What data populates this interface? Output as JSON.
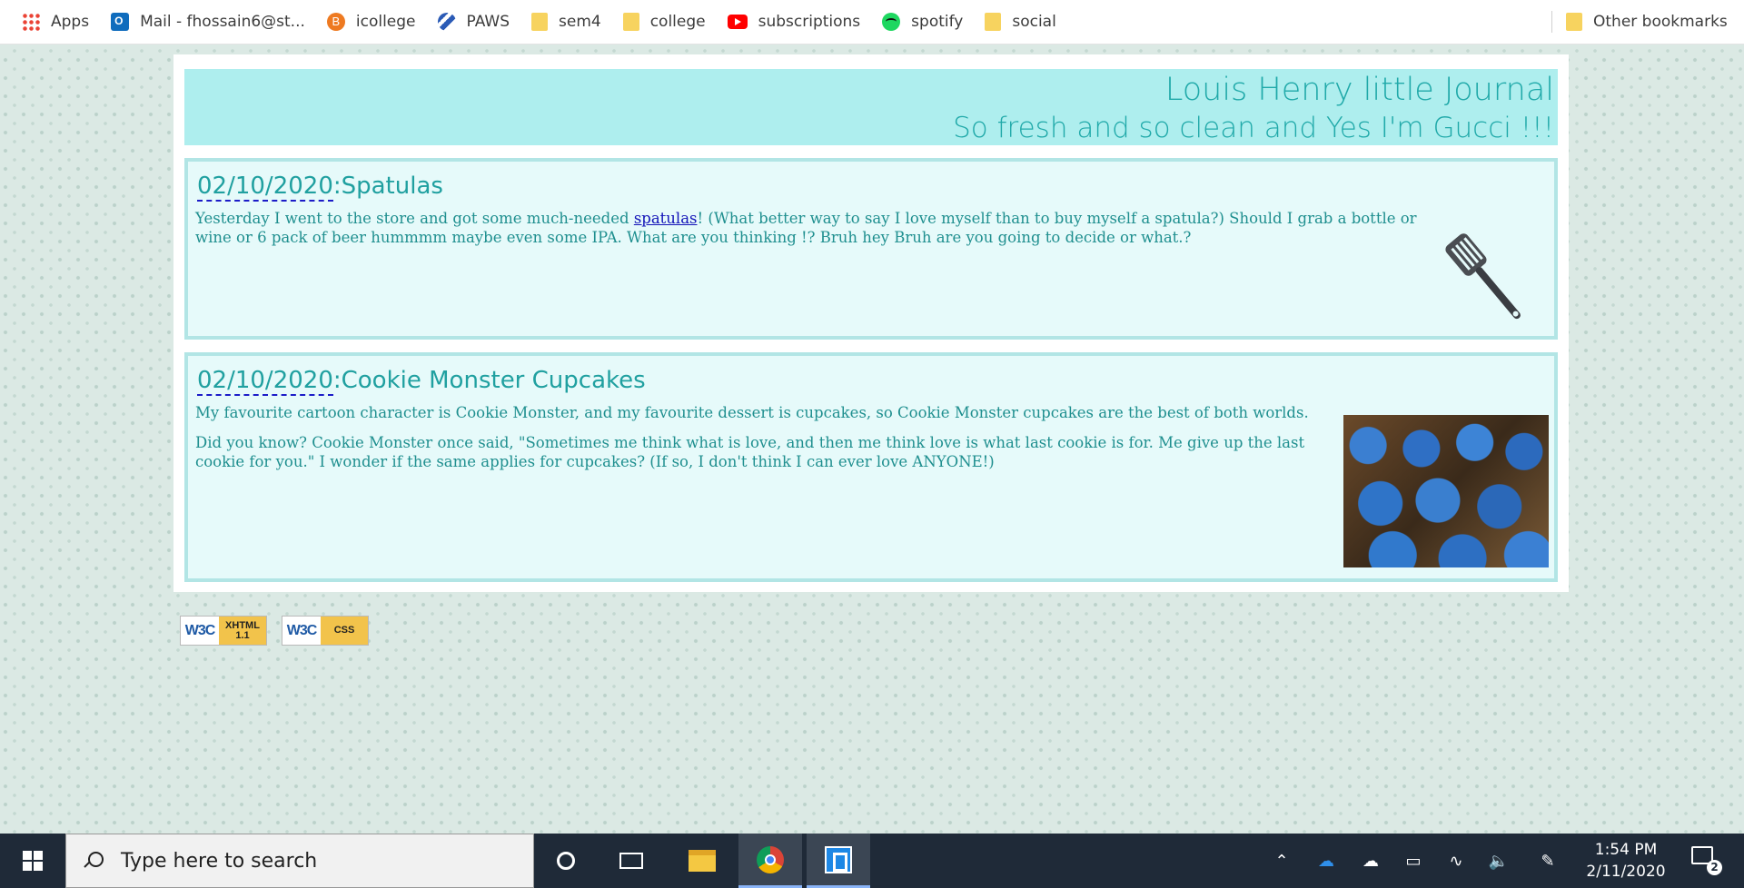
{
  "bookmarks": {
    "items": [
      {
        "label": "Apps",
        "icon": "apps-grid-icon"
      },
      {
        "label": "Mail - fhossain6@st...",
        "icon": "outlook-icon"
      },
      {
        "label": "icollege",
        "icon": "icollege-icon"
      },
      {
        "label": "PAWS",
        "icon": "paws-icon"
      },
      {
        "label": "sem4",
        "icon": "folder-icon"
      },
      {
        "label": "college",
        "icon": "folder-icon"
      },
      {
        "label": "subscriptions",
        "icon": "youtube-icon"
      },
      {
        "label": "spotify",
        "icon": "spotify-icon"
      },
      {
        "label": "social",
        "icon": "folder-icon"
      }
    ],
    "other": "Other bookmarks"
  },
  "header": {
    "title": "Louis Henry little Journal",
    "subtitle": "So fresh and so clean and Yes I'm Gucci !!!"
  },
  "entries": [
    {
      "date": "02/10/2020",
      "title": ":Spatulas",
      "p1_before": "Yesterday I went to the store and got some much-needed ",
      "p1_link": "spatulas",
      "p1_after": "! (What better way to say I love myself than to buy myself a spatula?) Should I grab a bottle or wine or 6 pack of beer hummmm maybe even some IPA. What are you thinking !? Bruh hey Bruh are you going to decide or what.?",
      "image": "spatula-image"
    },
    {
      "date": "02/10/2020",
      "title": ":Cookie Monster Cupcakes",
      "p1": "My favourite cartoon character is Cookie Monster, and my favourite dessert is cupcakes, so Cookie Monster cupcakes are the best of both worlds.",
      "p2": "Did you know? Cookie Monster once said, \"Sometimes me think what is love, and then me think love is what last cookie is for. Me give up the last cookie for you.\" I wonder if the same applies for cupcakes? (If so, I don't think I can ever love ANYONE!)",
      "image": "cookie-monster-cupcakes-image"
    }
  ],
  "badges": [
    {
      "w3c": "W3C",
      "kind": "XHTML 1.1"
    },
    {
      "w3c": "W3C",
      "kind": "CSS"
    }
  ],
  "taskbar": {
    "search_placeholder": "Type here to search",
    "time": "1:54 PM",
    "date": "2/11/2020",
    "notification_count": "2"
  },
  "colors": {
    "banner_bg": "#aeeeee",
    "banner_text": "#20a9a9",
    "entry_bg": "#e6fafa",
    "entry_border": "#b2e5e5",
    "link": "#1313b8",
    "taskbar_bg": "#1f2a38"
  }
}
